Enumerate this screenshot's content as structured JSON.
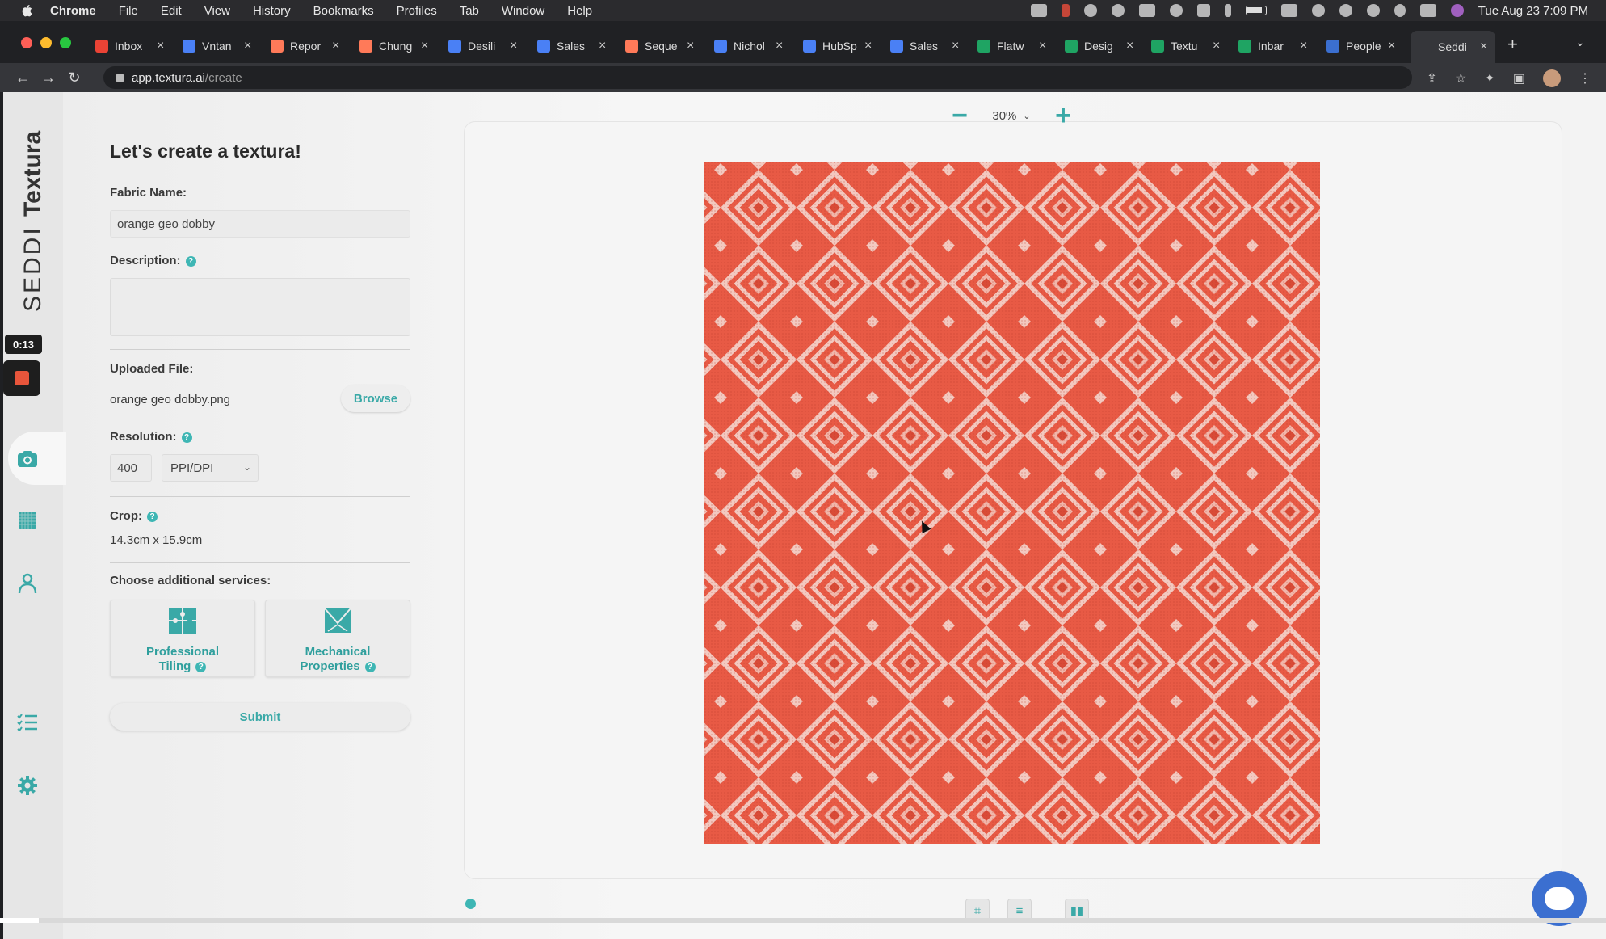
{
  "menubar": {
    "app": "Chrome",
    "items": [
      "File",
      "Edit",
      "View",
      "History",
      "Bookmarks",
      "Profiles",
      "Tab",
      "Window",
      "Help"
    ],
    "clock": "Tue Aug 23  7:09 PM"
  },
  "tabs": [
    {
      "label": "Inbox",
      "favicon": "gmail-icon",
      "color": "#ea4335"
    },
    {
      "label": "Vntan",
      "favicon": "docs-icon",
      "color": "#4a80f5"
    },
    {
      "label": "Repor",
      "favicon": "hubspot-icon",
      "color": "#ff7a59"
    },
    {
      "label": "Chung",
      "favicon": "hubspot-icon",
      "color": "#ff7a59"
    },
    {
      "label": "Desili",
      "favicon": "calendar-icon",
      "color": "#4a80f5"
    },
    {
      "label": "Sales",
      "favicon": "docs-icon",
      "color": "#4a80f5"
    },
    {
      "label": "Seque",
      "favicon": "hubspot-icon",
      "color": "#ff7a59"
    },
    {
      "label": "Nichol",
      "favicon": "docs-icon",
      "color": "#4a80f5"
    },
    {
      "label": "HubSp",
      "favicon": "docs-icon",
      "color": "#4a80f5"
    },
    {
      "label": "Sales",
      "favicon": "docs-icon",
      "color": "#4a80f5"
    },
    {
      "label": "Flatw",
      "favicon": "sheets-icon",
      "color": "#1fa463"
    },
    {
      "label": "Desig",
      "favicon": "sheets-icon",
      "color": "#1fa463"
    },
    {
      "label": "Textu",
      "favicon": "sheets-icon",
      "color": "#1fa463"
    },
    {
      "label": "Inbar",
      "favicon": "sheets-icon",
      "color": "#1fa463"
    },
    {
      "label": "People",
      "favicon": "people-icon",
      "color": "#3b6fd0"
    },
    {
      "label": "Seddi",
      "favicon": "seddi-icon",
      "color": "#35363a"
    }
  ],
  "address": {
    "host": "app.textura.ai",
    "path": "/create"
  },
  "sidebar": {
    "brand_seddi": "SEDDI",
    "brand_textura": "Textura",
    "timer": "0:13"
  },
  "form": {
    "title": "Let's create a textura!",
    "fabric_label": "Fabric Name:",
    "fabric_value": "orange geo dobby",
    "description_label": "Description:",
    "uploaded_label": "Uploaded File:",
    "uploaded_file": "orange geo dobby.png",
    "browse": "Browse",
    "resolution_label": "Resolution:",
    "resolution_value": "400",
    "resolution_unit": "PPI/DPI",
    "crop_label": "Crop:",
    "crop_value": "14.3cm x 15.9cm",
    "services_label": "Choose additional services:",
    "services": [
      {
        "line1": "Professional",
        "line2": "Tiling"
      },
      {
        "line1": "Mechanical",
        "line2": "Properties"
      }
    ],
    "submit": "Submit"
  },
  "viewer": {
    "zoom": "30%",
    "fabric_color": "#e85a45",
    "accent": "#3aa9a7"
  }
}
